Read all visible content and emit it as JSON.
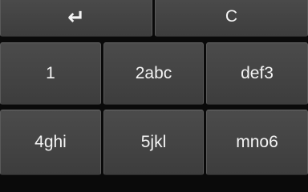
{
  "top_row": {
    "enter_icon": "enter-return-icon",
    "enter_glyph": "↵",
    "clear_label": "C"
  },
  "keys": {
    "k1": "1",
    "k2": "2abc",
    "k3": "def3",
    "k4": "4ghi",
    "k5": "5jkl",
    "k6": "mno6"
  },
  "colors": {
    "background": "#0a0a0a",
    "key_face": "#444444",
    "text": "#f4f4f4"
  }
}
